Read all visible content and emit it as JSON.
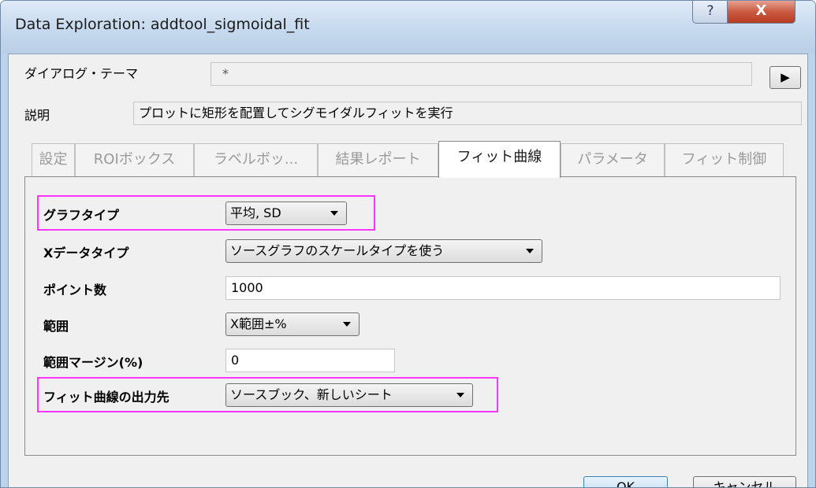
{
  "window": {
    "title": "Data Exploration: addtool_sigmoidal_fit",
    "help_glyph": "?",
    "close_glyph": "X"
  },
  "theme": {
    "label": "ダイアログ・テーマ",
    "value": "*",
    "arrow": "▶"
  },
  "description": {
    "label": "説明",
    "text": "プロットに矩形を配置してシグモイダルフィットを実行"
  },
  "tabs": [
    {
      "label": "設定"
    },
    {
      "label": "ROIボックス"
    },
    {
      "label": "ラベルボッ..."
    },
    {
      "label": "結果レポート"
    },
    {
      "label": "フィット曲線"
    },
    {
      "label": "パラメータ"
    },
    {
      "label": "フィット制御"
    }
  ],
  "active_tab": "フィット曲線",
  "fields": {
    "graph_type": {
      "label": "グラフタイプ",
      "value": "平均, SD"
    },
    "x_data_type": {
      "label": "Xデータタイプ",
      "value": "ソースグラフのスケールタイプを使う"
    },
    "num_points": {
      "label": "ポイント数",
      "value": "1000"
    },
    "range": {
      "label": "範囲",
      "value": "X範囲±%"
    },
    "range_margin": {
      "label": "範囲マージン(%)",
      "value": "0"
    },
    "output": {
      "label": "フィット曲線の出力先",
      "value": "ソースブック、新しいシート"
    }
  },
  "buttons": {
    "ok": "OK",
    "cancel": "キャンセル"
  },
  "colors": {
    "highlight": "#ff35ff",
    "titlebar": "#c6d9ee",
    "close_button": "#c95a41"
  }
}
